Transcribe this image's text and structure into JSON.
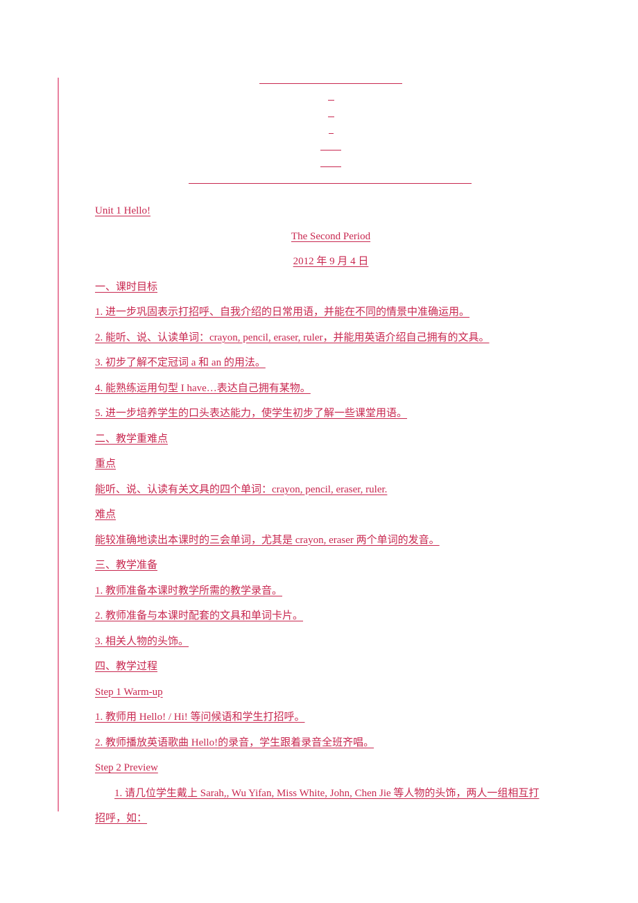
{
  "document": {
    "type": "lesson-plan",
    "language": "zh-CN",
    "text_color": "#c8274f",
    "margin_bar_color": "#e8829f",
    "header_blanks": [
      {
        "id": "blank-title",
        "label": ""
      },
      {
        "id": "blank-field-1",
        "label": ""
      },
      {
        "id": "blank-field-2",
        "label": ""
      },
      {
        "id": "blank-field-3",
        "label": ""
      },
      {
        "id": "blank-field-4",
        "label": ""
      },
      {
        "id": "blank-field-5",
        "label": ""
      },
      {
        "id": "horizontal-rule",
        "label": ""
      }
    ],
    "unit_title": "Unit 1 Hello!",
    "period_title": "The Second Period",
    "date": "2012 年 9 月 4 日",
    "sections": [
      {
        "heading": "一、课时目标",
        "items": [
          "1. 进一步巩固表示打招呼、自我介绍的日常用语，并能在不同的情景中准确运用。",
          "2. 能听、说、认读单词：crayon, pencil, eraser, ruler，并能用英语介绍自己拥有的文具。",
          "3. 初步了解不定冠词 a 和 an 的用法。",
          "4. 能熟练运用句型 I have…表达自己拥有某物。",
          "5. 进一步培养学生的口头表达能力，使学生初步了解一些课堂用语。"
        ]
      },
      {
        "heading": "二、教学重难点",
        "items": [
          "重点",
          "能听、说、认读有关文具的四个单词：crayon, pencil, eraser, ruler.",
          "难点",
          "能较准确地读出本课时的三会单词，尤其是 crayon, eraser 两个单词的发音。"
        ]
      },
      {
        "heading": "三、教学准备",
        "items": [
          "1. 教师准备本课时教学所需的教学录音。",
          "2. 教师准备与本课时配套的文具和单词卡片。",
          "3. 相关人物的头饰。"
        ]
      },
      {
        "heading": "四、教学过程",
        "items": [
          "Step 1 Warm-up",
          "1. 教师用 Hello! / Hi!  等问候语和学生打招呼。",
          "2. 教师播放英语歌曲 Hello!的录音，学生跟着录音全班齐唱。",
          "Step 2 Preview"
        ]
      }
    ],
    "final_paragraph": "1. 请几位学生戴上 Sarah,, Wu Yifan, Miss White, John, Chen Jie 等人物的头饰，两人一组相互打招呼，如："
  }
}
